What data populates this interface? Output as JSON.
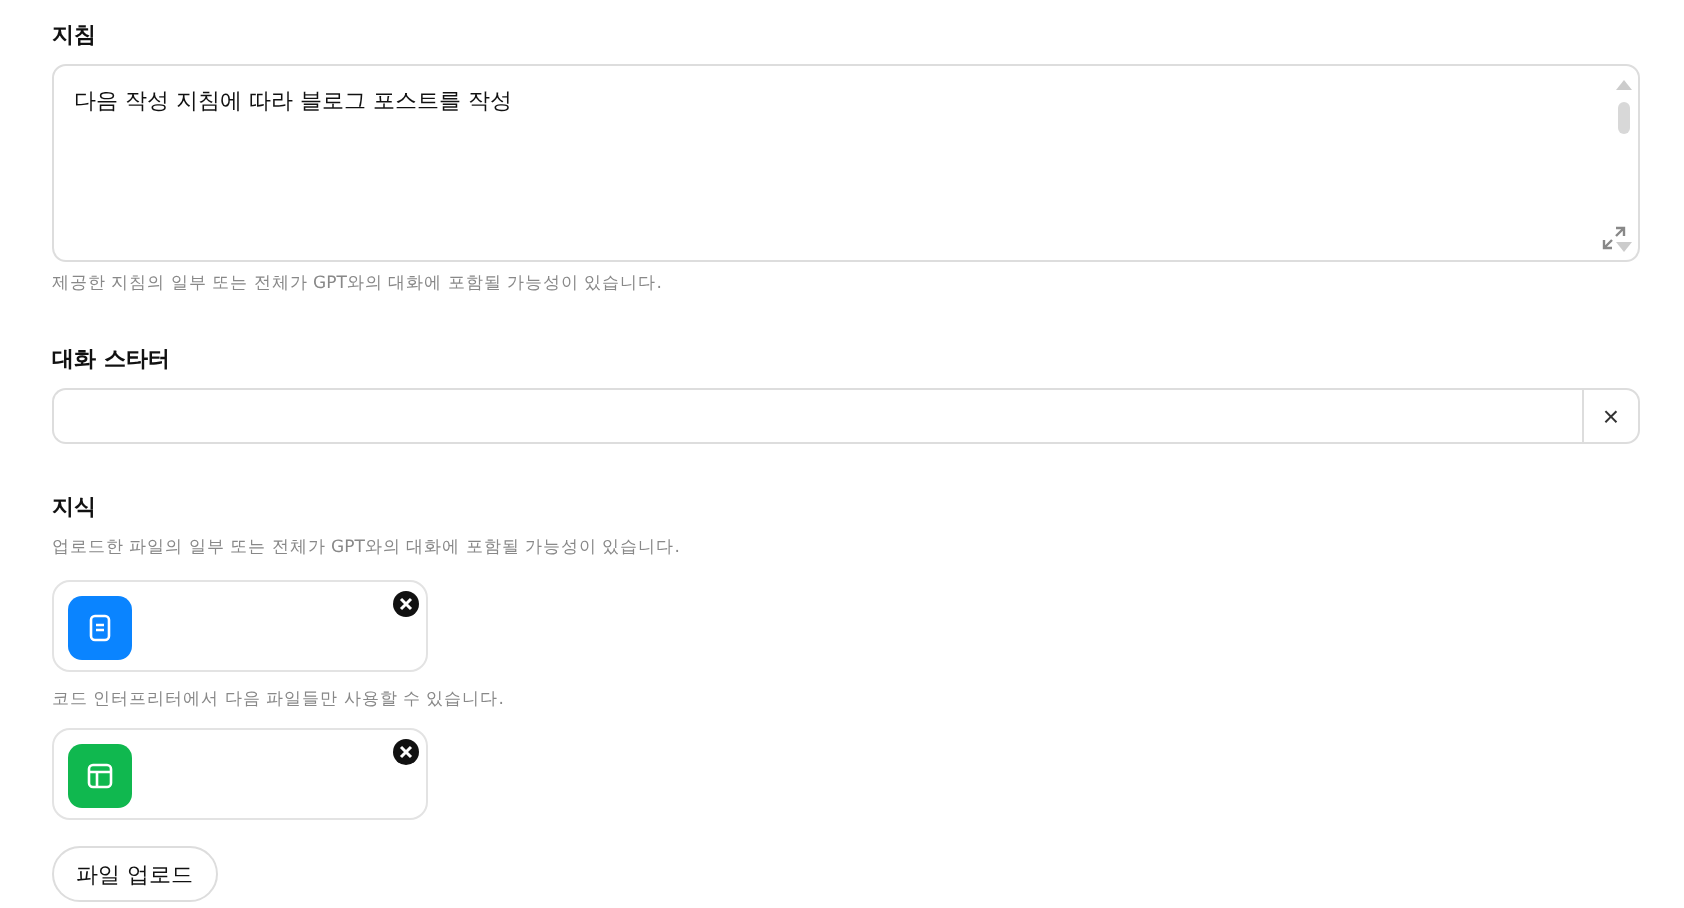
{
  "instructions": {
    "label": "지침",
    "value": "다음 작성 지침에 따라 블로그 포스트를 작성",
    "hint": "제공한 지침의 일부 또는 전체가 GPT와의 대화에 포함될 가능성이 있습니다."
  },
  "conversation_starter": {
    "label": "대화 스타터",
    "clear": "×"
  },
  "knowledge": {
    "label": "지식",
    "hint": "업로드한 파일의 일부 또는 전체가 GPT와의 대화에 포함될 가능성이 있습니다.",
    "groups": [
      {
        "files": [
          {
            "kind": "document"
          }
        ]
      },
      {
        "note": "코드 인터프리터에서 다음 파일들만 사용할 수 있습니다.",
        "files": [
          {
            "kind": "spreadsheet"
          }
        ]
      }
    ],
    "upload": "파일 업로드"
  }
}
